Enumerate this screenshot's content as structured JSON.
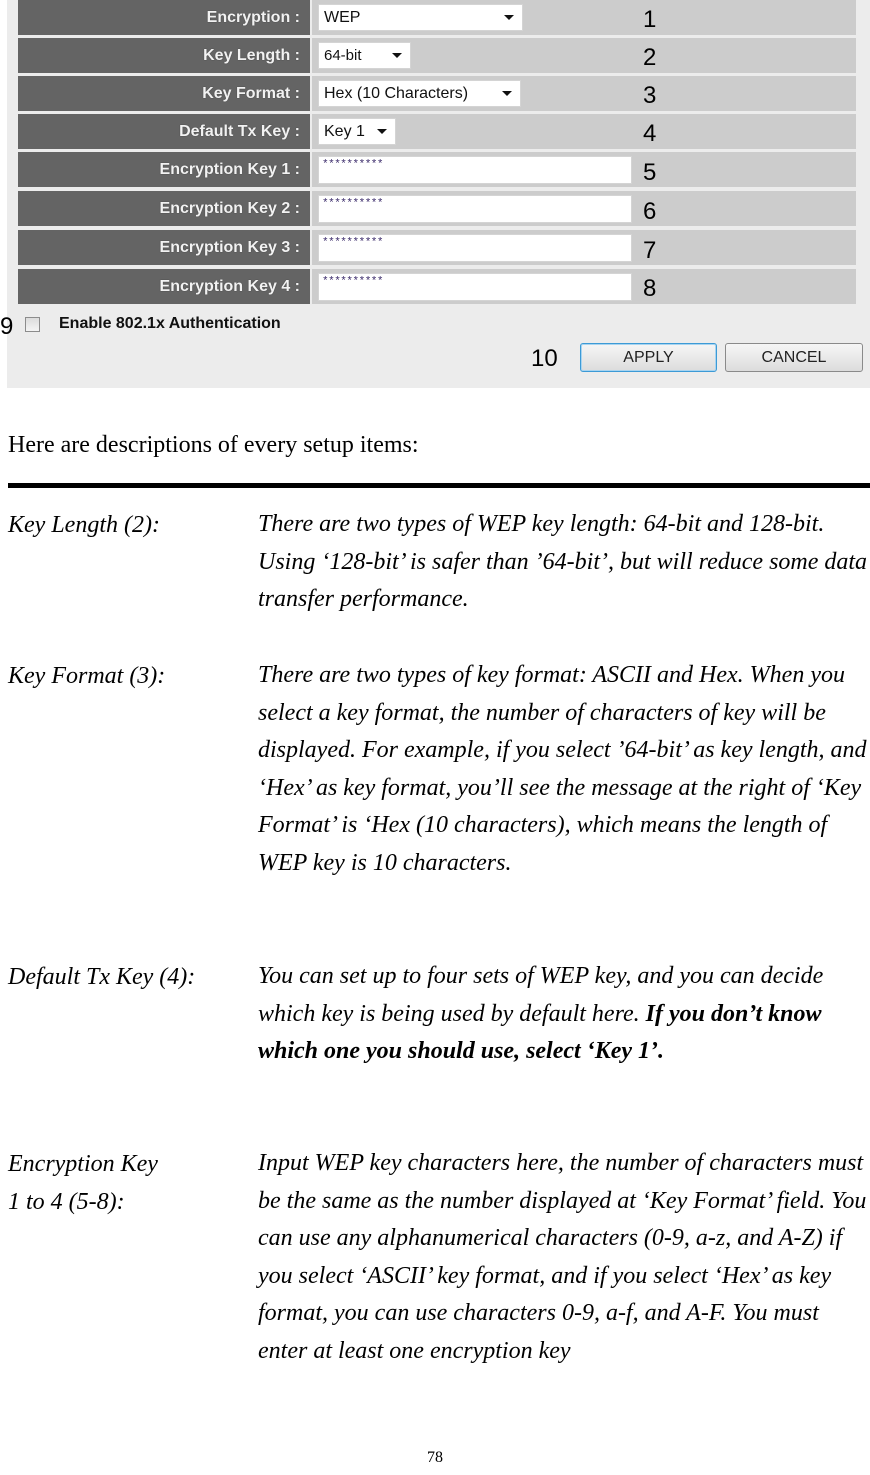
{
  "form": {
    "rows": [
      {
        "label": "Encryption :",
        "value": "WEP",
        "control": "select",
        "marker": "1"
      },
      {
        "label": "Key Length :",
        "value": "64-bit",
        "control": "select",
        "marker": "2"
      },
      {
        "label": "Key Format :",
        "value": "Hex (10 Characters)",
        "control": "select",
        "marker": "3"
      },
      {
        "label": "Default Tx Key :",
        "value": "Key 1",
        "control": "select",
        "marker": "4"
      },
      {
        "label": "Encryption Key 1 :",
        "value": "**********",
        "control": "password",
        "marker": "5"
      },
      {
        "label": "Encryption Key 2 :",
        "value": "**********",
        "control": "password",
        "marker": "6"
      },
      {
        "label": "Encryption Key 3 :",
        "value": "**********",
        "control": "password",
        "marker": "7"
      },
      {
        "label": "Encryption Key 4 :",
        "value": "**********",
        "control": "password",
        "marker": "8"
      }
    ],
    "checkbox": {
      "label": "Enable 802.1x Authentication",
      "checked": false,
      "marker": "9"
    },
    "buttons": {
      "apply": "APPLY",
      "cancel": "CANCEL",
      "marker": "10"
    }
  },
  "document": {
    "intro": "Here are descriptions of every setup items:",
    "items": [
      {
        "term": "Key Length (2):",
        "description": "There are two types of WEP key length: 64-bit and 128-bit. Using ‘128-bit’ is safer than ’64-bit’, but will reduce some data transfer performance."
      },
      {
        "term": "Key Format (3):",
        "description": "There are two types of key format: ASCII and Hex. When you select a key format, the number of characters of key will be displayed. For example, if you select ’64-bit’ as key length, and ‘Hex’ as key format, you’ll see the message at the right of ‘Key Format’ is ‘Hex (10 characters), which means the length of WEP key is 10 characters."
      },
      {
        "term": "Default Tx Key (4):",
        "description": "You can set up to four sets of WEP key, and you can decide which key is being used by default here.",
        "description_bold": "If you don’t know which one you should use, select ‘Key 1’."
      },
      {
        "term_line1": "Encryption Key",
        "term_line2": "1 to 4 (5-8):",
        "description": "Input WEP key characters here, the number of characters must be the same as the number displayed at ‘Key Format’ field. You can use any alphanumerical characters (0-9, a-z, and A-Z) if you select ‘ASCII’ key format, and if you select ‘Hex’ as key format, you can use characters 0-9, a-f, and A-F. You must enter at least one encryption key"
      }
    ],
    "page_number": "78"
  }
}
